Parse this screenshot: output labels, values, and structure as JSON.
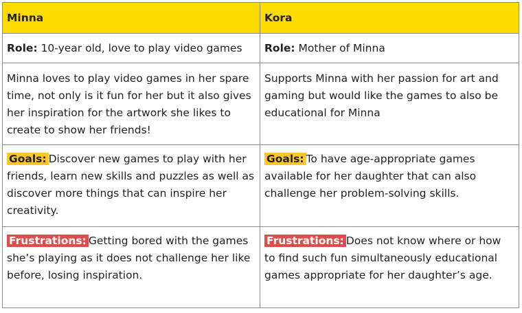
{
  "columns": [
    {
      "name": "Minna",
      "role_label": "Role:",
      "role_text": " 10-year old, love to play video games",
      "description": "Minna loves to play video games in her spare time, not only is it fun for her but it also gives her inspiration for the artwork she likes to create to show her friends!",
      "goals_label": "Goals:",
      "goals_text": "Discover new games to play with her friends, learn new skills and puzzles as well as discover more things that can inspire her creativity.",
      "frustrations_label": "Frustrations:",
      "frustrations_text": "Getting bored with the games she’s playing as it does not challenge her like before, losing inspiration."
    },
    {
      "name": "Kora",
      "role_label": "Role:",
      "role_text": " Mother of Minna",
      "description": "Supports Minna with her passion for art and gaming but would like the games to also be educational for Minna",
      "goals_label": "Goals:",
      "goals_text": "To have age-appropriate games available for her daughter that can also challenge her problem-solving skills.",
      "frustrations_label": "Frustrations:",
      "frustrations_text": "Does not know where or how to find such fun simultaneously educational games appropriate for her daughter’s age."
    }
  ],
  "colors": {
    "header_bg": "#fedc00",
    "goals_tag_bg": "#fdc629",
    "frustrations_tag_bg": "#e24b4b",
    "frustrations_tag_text": "#ffffff",
    "border": "#8a8a8a"
  }
}
